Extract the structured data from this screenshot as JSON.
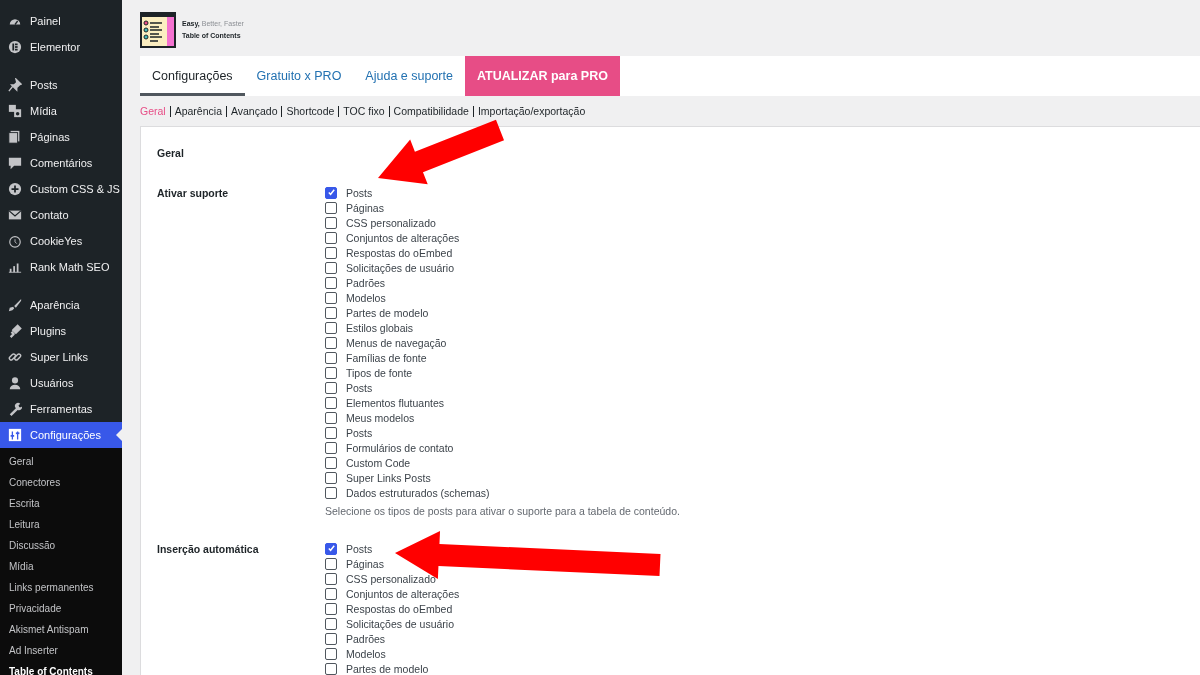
{
  "sidebar": {
    "groups": [
      {
        "items": [
          {
            "label": "Painel",
            "selected": false
          },
          {
            "label": "Elementor",
            "selected": false
          }
        ]
      },
      {
        "items": [
          {
            "label": "Posts",
            "selected": false
          },
          {
            "label": "Mídia",
            "selected": false
          },
          {
            "label": "Páginas",
            "selected": false
          },
          {
            "label": "Comentários",
            "selected": false
          },
          {
            "label": "Custom CSS & JS",
            "selected": false
          },
          {
            "label": "Contato",
            "selected": false
          },
          {
            "label": "CookieYes",
            "selected": false
          },
          {
            "label": "Rank Math SEO",
            "selected": false
          }
        ]
      },
      {
        "items": [
          {
            "label": "Aparência",
            "selected": false
          },
          {
            "label": "Plugins",
            "selected": false
          },
          {
            "label": "Super Links",
            "selected": false
          },
          {
            "label": "Usuários",
            "selected": false
          },
          {
            "label": "Ferramentas",
            "selected": false
          },
          {
            "label": "Configurações",
            "selected": true
          }
        ]
      }
    ],
    "submenu": [
      {
        "label": "Geral",
        "selected": false
      },
      {
        "label": "Conectores",
        "selected": false
      },
      {
        "label": "Escrita",
        "selected": false
      },
      {
        "label": "Leitura",
        "selected": false
      },
      {
        "label": "Discussão",
        "selected": false
      },
      {
        "label": "Mídia",
        "selected": false
      },
      {
        "label": "Links permanentes",
        "selected": false
      },
      {
        "label": "Privacidade",
        "selected": false
      },
      {
        "label": "Akismet Antispam",
        "selected": false
      },
      {
        "label": "Ad Inserter",
        "selected": false
      },
      {
        "label": "Table of Contents",
        "selected": true
      }
    ]
  },
  "header": {
    "tagline": [
      "Easy,",
      "Better,",
      "Faster"
    ],
    "title": "Table of Contents"
  },
  "tabs": [
    {
      "label": "Configurações",
      "selected": true,
      "kind": "tab"
    },
    {
      "label": "Gratuito x PRO",
      "selected": false,
      "kind": "tab"
    },
    {
      "label": "Ajuda e suporte",
      "selected": false,
      "kind": "tab"
    },
    {
      "label": "ATUALIZAR para PRO",
      "selected": false,
      "kind": "upgrade"
    }
  ],
  "subnav": [
    {
      "label": "Geral",
      "selected": true
    },
    {
      "label": "Aparência",
      "selected": false
    },
    {
      "label": "Avançado",
      "selected": false
    },
    {
      "label": "Shortcode",
      "selected": false
    },
    {
      "label": "TOC fixo",
      "selected": false
    },
    {
      "label": "Compatibilidade",
      "selected": false
    },
    {
      "label": "Importação/exportação",
      "selected": false
    }
  ],
  "settings": {
    "section_title": "Geral",
    "rows": [
      {
        "label": "Ativar suporte",
        "options": [
          {
            "label": "Posts",
            "checked": true
          },
          {
            "label": "Páginas",
            "checked": false
          },
          {
            "label": "CSS personalizado",
            "checked": false
          },
          {
            "label": "Conjuntos de alterações",
            "checked": false
          },
          {
            "label": "Respostas do oEmbed",
            "checked": false
          },
          {
            "label": "Solicitações de usuário",
            "checked": false
          },
          {
            "label": "Padrões",
            "checked": false
          },
          {
            "label": "Modelos",
            "checked": false
          },
          {
            "label": "Partes de modelo",
            "checked": false
          },
          {
            "label": "Estilos globais",
            "checked": false
          },
          {
            "label": "Menus de navegação",
            "checked": false
          },
          {
            "label": "Famílias de fonte",
            "checked": false
          },
          {
            "label": "Tipos de fonte",
            "checked": false
          },
          {
            "label": "Posts",
            "checked": false
          },
          {
            "label": "Elementos flutuantes",
            "checked": false
          },
          {
            "label": "Meus modelos",
            "checked": false
          },
          {
            "label": "Posts",
            "checked": false
          },
          {
            "label": "Formulários de contato",
            "checked": false
          },
          {
            "label": "Custom Code",
            "checked": false
          },
          {
            "label": "Super Links Posts",
            "checked": false
          },
          {
            "label": "Dados estruturados (schemas)",
            "checked": false
          }
        ],
        "description": "Selecione os tipos de posts para ativar o suporte para a tabela de conteúdo."
      },
      {
        "label": "Inserção automática",
        "options": [
          {
            "label": "Posts",
            "checked": true
          },
          {
            "label": "Páginas",
            "checked": false
          },
          {
            "label": "CSS personalizado",
            "checked": false
          },
          {
            "label": "Conjuntos de alterações",
            "checked": false
          },
          {
            "label": "Respostas do oEmbed",
            "checked": false
          },
          {
            "label": "Solicitações de usuário",
            "checked": false
          },
          {
            "label": "Padrões",
            "checked": false
          },
          {
            "label": "Modelos",
            "checked": false
          },
          {
            "label": "Partes de modelo",
            "checked": false
          }
        ]
      }
    ]
  }
}
